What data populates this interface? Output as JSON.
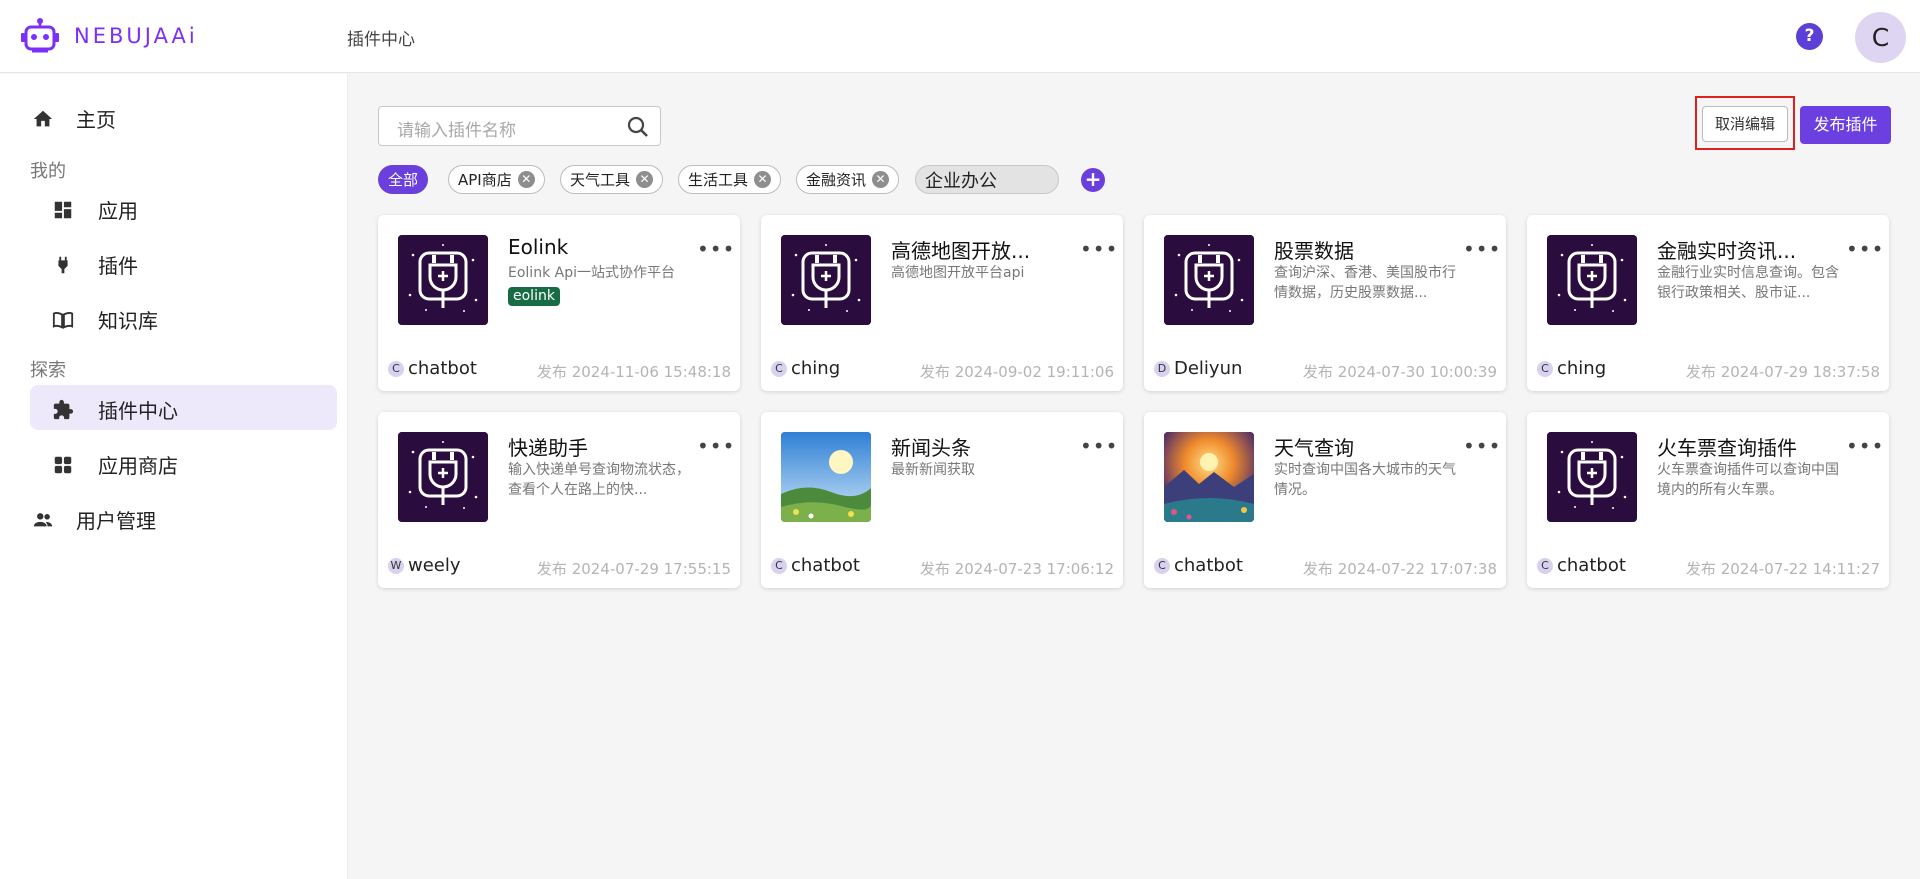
{
  "header": {
    "logo_text": "NEBUJAAi",
    "page_title": "插件中心",
    "help_label": "?",
    "avatar_letter": "C"
  },
  "sidebar": {
    "home": "主页",
    "section_mine": "我的",
    "apps": "应用",
    "plugins": "插件",
    "knowledge": "知识库",
    "section_explore": "探索",
    "plugin_center": "插件中心",
    "app_store": "应用商店",
    "user_mgmt": "用户管理"
  },
  "toolbar": {
    "search_placeholder": "请输入插件名称",
    "cancel_edit": "取消编辑",
    "publish": "发布插件"
  },
  "chips": {
    "all": "全部",
    "items": [
      "API商店",
      "天气工具",
      "生活工具",
      "金融资讯"
    ],
    "editing_value": "企业办公",
    "add": "+"
  },
  "cards": [
    {
      "title": "Eolink",
      "desc": "Eolink Api一站式协作平台",
      "tag": "eolink",
      "author_initial": "C",
      "author": "chatbot",
      "date": "发布 2024-11-06 15:48:18",
      "icon": "plug-icon"
    },
    {
      "title": "高德地图开放...",
      "desc": "高德地图开放平台api",
      "author_initial": "C",
      "author": "ching",
      "date": "发布 2024-09-02 19:11:06",
      "icon": "plug-icon"
    },
    {
      "title": "股票数据",
      "desc": "查询沪深、香港、美国股市行情数据，历史股票数据...",
      "author_initial": "D",
      "author": "Deliyun",
      "date": "发布 2024-07-30 10:00:39",
      "icon": "plug-icon"
    },
    {
      "title": "金融实时资讯...",
      "desc": "金融行业实时信息查询。包含银行政策相关、股市证...",
      "author_initial": "C",
      "author": "ching",
      "date": "发布 2024-07-29 18:37:58",
      "icon": "plug-icon"
    },
    {
      "title": "快递助手",
      "desc": "输入快递单号查询物流状态，查看个人在路上的快...",
      "author_initial": "W",
      "author": "weely",
      "date": "发布 2024-07-29 17:55:15",
      "icon": "plug-icon"
    },
    {
      "title": "新闻头条",
      "desc": "最新新闻获取",
      "author_initial": "C",
      "author": "chatbot",
      "date": "发布 2024-07-23 17:06:12",
      "icon": "landscape-image"
    },
    {
      "title": "天气查询",
      "desc": "实时查询中国各大城市的天气情况。",
      "author_initial": "C",
      "author": "chatbot",
      "date": "发布 2024-07-22 17:07:38",
      "icon": "sunset-image"
    },
    {
      "title": "火车票查询插件",
      "desc": "火车票查询插件可以查询中国境内的所有火车票。",
      "author_initial": "C",
      "author": "chatbot",
      "date": "发布 2024-07-22 14:11:27",
      "icon": "plug-icon"
    }
  ],
  "colors": {
    "accent": "#6a3fdc",
    "brand": "#7b2ff7",
    "highlight_border": "#e02020"
  }
}
